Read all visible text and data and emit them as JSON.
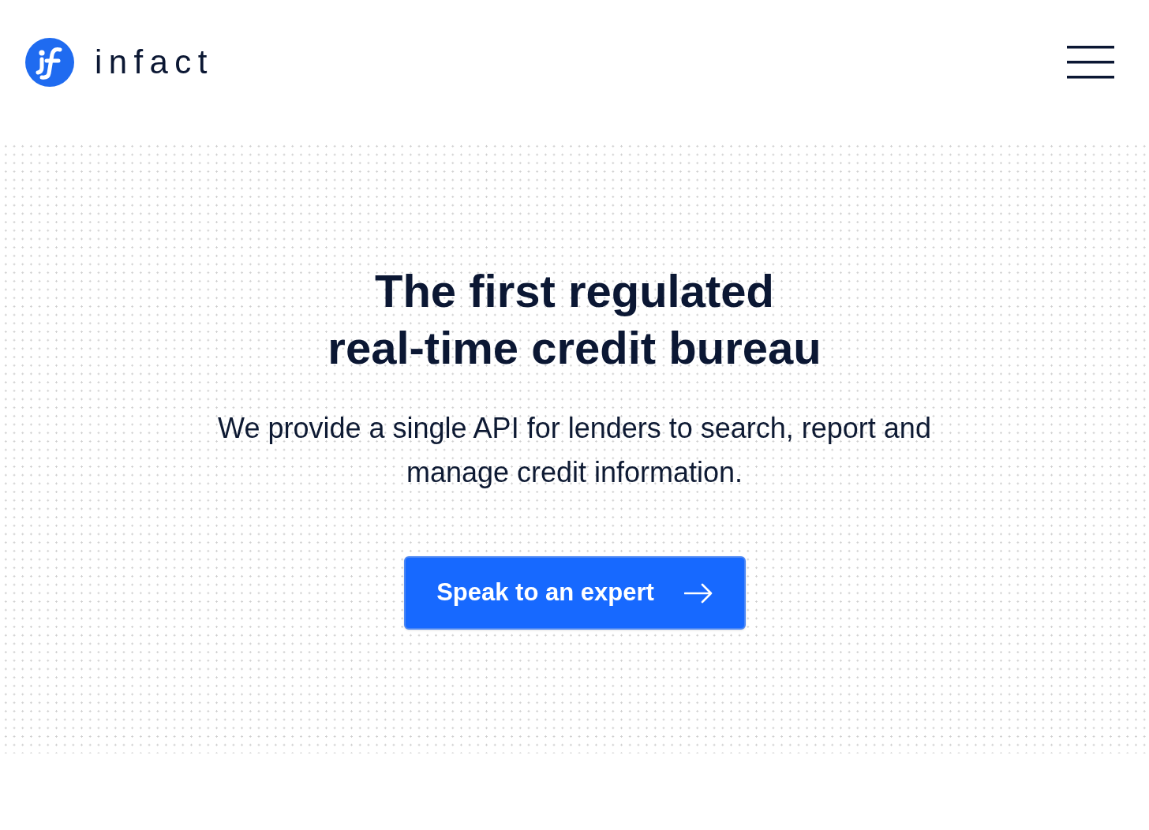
{
  "header": {
    "brand": "infact"
  },
  "hero": {
    "title_lines": [
      "The first regulated",
      "real-time credit bureau"
    ],
    "subtitle": "We provide a single API for lenders to search, report and manage credit information.",
    "cta": {
      "label": "Speak to an expert"
    }
  }
}
